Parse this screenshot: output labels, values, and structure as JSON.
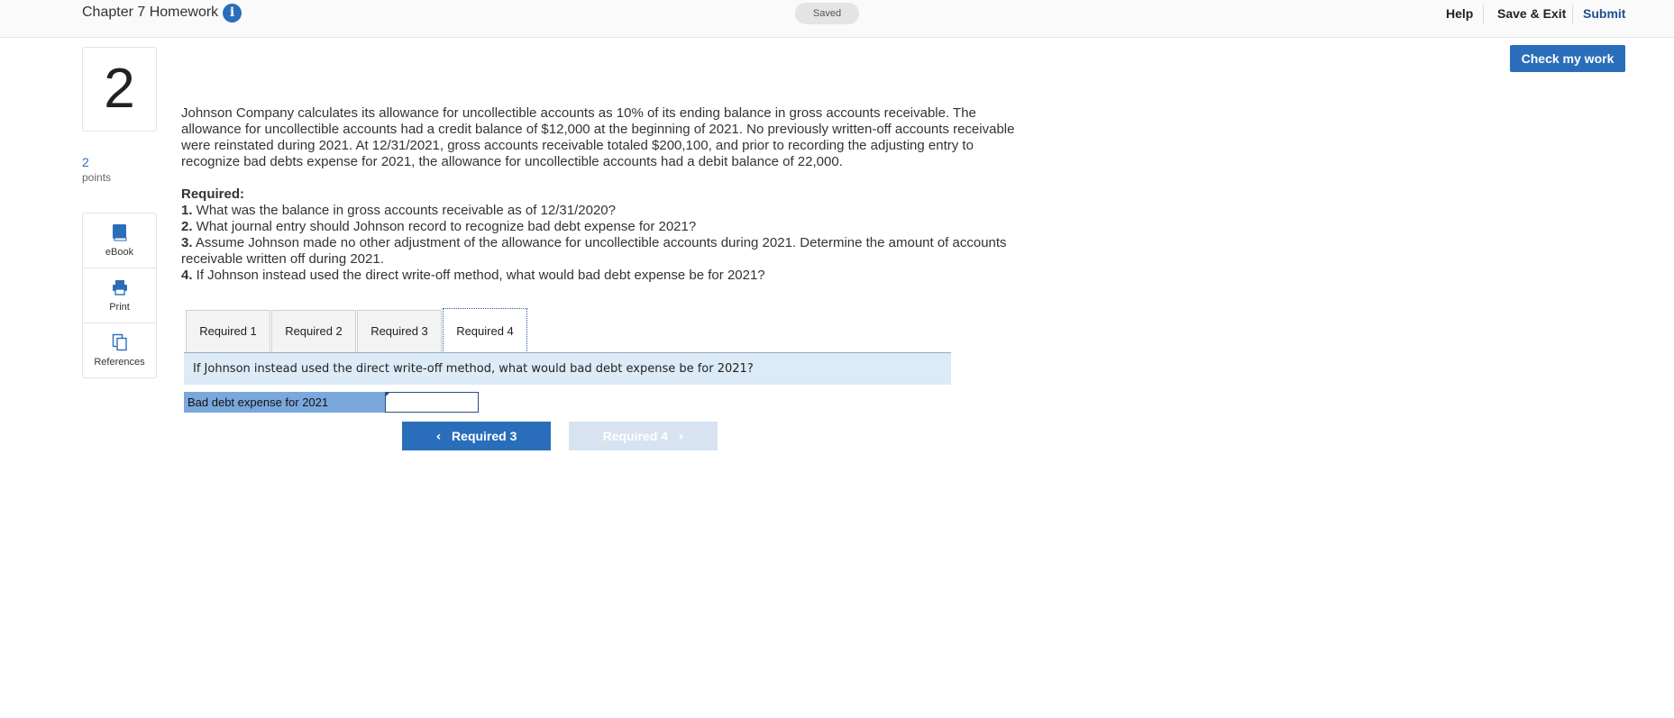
{
  "header": {
    "title": "Chapter 7 Homework",
    "info_icon": "i",
    "status": "Saved",
    "help": "Help",
    "save_exit": "Save & Exit",
    "submit": "Submit"
  },
  "actions": {
    "check_my_work": "Check my work"
  },
  "question": {
    "number": "2",
    "points_value": "2",
    "points_label": "points",
    "problem_text": "Johnson Company calculates its allowance for uncollectible accounts as 10% of its ending balance in gross accounts receivable. The allowance for uncollectible accounts had a credit balance of $12,000 at the beginning of 2021.  No previously written-off accounts receivable were reinstated during 2021.  At 12/31/2021, gross accounts receivable totaled $200,100, and prior to recording the adjusting entry to recognize bad debts expense for 2021, the allowance for uncollectible accounts had a debit balance of 22,000.",
    "required_heading": "Required:",
    "requirements": [
      {
        "num": "1.",
        "text": " What was the balance in gross accounts receivable as of 12/31/2020?"
      },
      {
        "num": "2.",
        "text": " What journal entry should Johnson record to recognize bad debt expense for 2021?"
      },
      {
        "num": "3.",
        "text": " Assume Johnson made no other adjustment of the allowance for uncollectible accounts during 2021. Determine the amount of accounts receivable written off during 2021."
      },
      {
        "num": "4.",
        "text": " If Johnson instead used the direct write-off method, what would bad debt expense be for 2021?"
      }
    ]
  },
  "tools": [
    {
      "label": "eBook",
      "icon": "book-icon"
    },
    {
      "label": "Print",
      "icon": "printer-icon"
    },
    {
      "label": "References",
      "icon": "references-icon"
    }
  ],
  "tabs": [
    {
      "label": "Required 1",
      "active": false
    },
    {
      "label": "Required 2",
      "active": false
    },
    {
      "label": "Required 3",
      "active": false
    },
    {
      "label": "Required 4",
      "active": true
    }
  ],
  "panel": {
    "question": "If Johnson instead used the direct write-off method, what would bad debt expense be for 2021?",
    "answer_label": "Bad debt expense for 2021",
    "answer_value": ""
  },
  "navigation": {
    "prev_label": "Required 3",
    "next_label": "Required 4",
    "prev_icon": "‹",
    "next_icon": "›"
  },
  "colors": {
    "brand_blue": "#2a6ebb",
    "band_blue": "#dcebf8",
    "label_blue": "#7aa7dc",
    "disabled_button": "#d7e3f1"
  }
}
